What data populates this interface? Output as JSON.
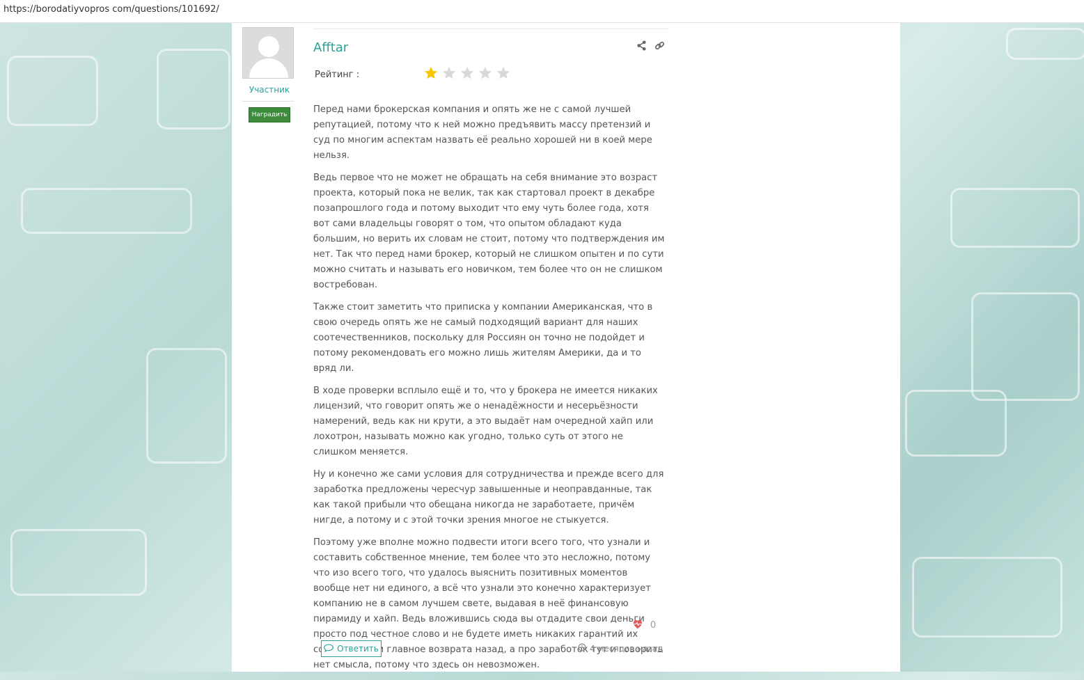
{
  "browser": {
    "url": "https://borodatiyvopros com/questions/101692/"
  },
  "user": {
    "name": "Afftar",
    "role": "Участник",
    "award_label": "Наградить"
  },
  "rating": {
    "label": "Рейтинг :",
    "value": 1,
    "max": 5,
    "filled_color": "#f7c600",
    "empty_color": "#d9d9d9"
  },
  "post": {
    "paragraphs": [
      "Перед нами брокерская компания и опять же не с самой лучшей репутацией, потому что к ней можно предъявить массу претензий и суд по многим аспектам назвать её реально хорошей ни в коей мере нельзя.",
      "Ведь первое что не может не обращать на себя внимание это возраст проекта, который пока не велик, так как стартовал проект в декабре позапрошлого года и потому выходит что ему чуть более года, хотя вот сами владельцы говорят о том, что опытом обладают куда большим, но верить их словам не стоит, потому что подтверждения им нет. Так что перед нами брокер, который не слишком опытен и по сути можно считать и называть его новичком, тем более что он не слишком востребован.",
      "Также стоит заметить что приписка у компании Американская, что в свою очередь опять же не самый подходящий вариант для наших соотечественников, поскольку для Россиян он точно не подойдет и потому рекомендовать его можно лишь жителям Америки, да и то вряд ли.",
      "В ходе проверки всплыло ещё и то, что у брокера не имеется никаких лицензий, что говорит опять же о ненадёжности и несерьёзности намерений, ведь как ни крути, а это выдаёт нам очередной хайп или лохотрон, называть можно как угодно, только суть от этого не слишком меняется.",
      "Ну и конечно же сами условия для сотрудничества и прежде всего для заработка предложены чересчур завышенные и неоправданные, так как такой прибыли что обещана никогда не заработаете, причём нигде, а потому и с этой точки зрения многое не стыкуется.",
      "Поэтому уже вполне можно подвести итоги всего того, что узнали и составить собственное мнение, тем более что это несложно, потому что изо всего того, что удалось выяснить позитивных моментов вообще нет ни единого, а всё что узнали это конечно характеризует компанию не в самом лучшем свете, выдавая в неё финансовую пирамиду и хайп. Ведь вложившись сюда вы отдадите свои деньги просто под честное слово и не будете иметь никаких гарантий их сохранности и главное возврата назад, а про заработок тут и говорить нет смысла, потому что здесь он невозможен."
    ],
    "likes": "0",
    "reply_label": "Ответить",
    "time": "4 месяцев назад"
  },
  "icons": {
    "share": "share-icon",
    "link": "link-icon",
    "heart": "heartbeat-icon",
    "reply": "comment-icon",
    "clock": "clock-icon"
  },
  "colors": {
    "accent": "#2aa198",
    "award_bg": "#3c8c3c"
  }
}
